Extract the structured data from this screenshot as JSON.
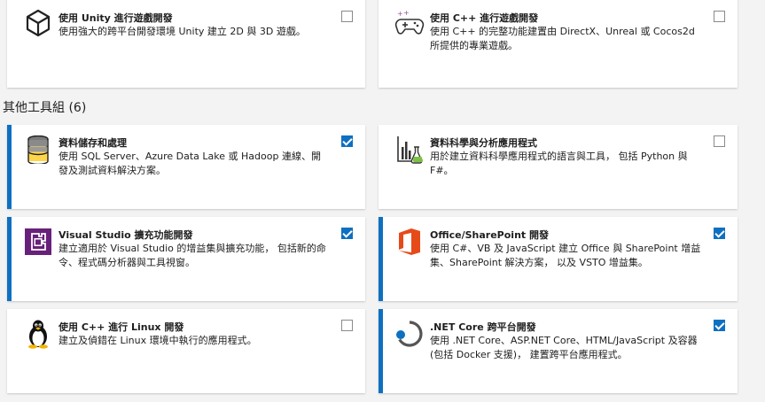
{
  "top_cards": [
    {
      "title": "使用 Unity 進行遊戲開發",
      "desc": "使用強大的跨平台開發環境 Unity 建立 2D 與 3D 遊戲。",
      "checked": false,
      "icon": "unity-icon"
    },
    {
      "title": "使用 C++ 進行遊戲開發",
      "desc": "使用 C++ 的完整功能建置由 DirectX、Unreal 或 Cocos2d 所提供的專業遊戲。",
      "checked": false,
      "icon": "gamepad-icon"
    }
  ],
  "section": {
    "title": "其他工具組 (6)"
  },
  "cards": [
    {
      "title": "資料儲存和處理",
      "desc": "使用 SQL Server、Azure Data Lake 或 Hadoop 連線、開發及測試資料解決方案。",
      "checked": true,
      "icon": "database-icon"
    },
    {
      "title": "資料科學與分析應用程式",
      "desc": "用於建立資料科學應用程式的語言與工具， 包括 Python 與 F#。",
      "checked": false,
      "icon": "data-science-icon"
    },
    {
      "title": "Visual Studio 擴充功能開發",
      "desc": "建立適用於 Visual Studio 的增益集與擴充功能， 包括新的命令、程式碼分析器與工具視窗。",
      "checked": true,
      "icon": "vs-extension-icon"
    },
    {
      "title": "Office/SharePoint 開發",
      "desc": "使用 C#、VB 及 JavaScript 建立 Office 與 SharePoint 增益集、SharePoint 解決方案， 以及 VSTO 增益集。",
      "checked": true,
      "icon": "office-icon"
    },
    {
      "title": "使用 C++ 進行 Linux 開發",
      "desc": "建立及偵錯在 Linux 環境中執行的應用程式。",
      "checked": false,
      "icon": "linux-penguin-icon"
    },
    {
      "title": ".NET Core 跨平台開發",
      "desc": "使用 .NET Core、ASP.NET Core、HTML/JavaScript 及容器 (包括 Docker 支援)， 建置跨平台應用程式。",
      "checked": true,
      "icon": "dotnet-core-icon"
    }
  ],
  "colors": {
    "accent": "#0e70c0",
    "office": "#e64a19",
    "vs_purple": "#68217a"
  }
}
